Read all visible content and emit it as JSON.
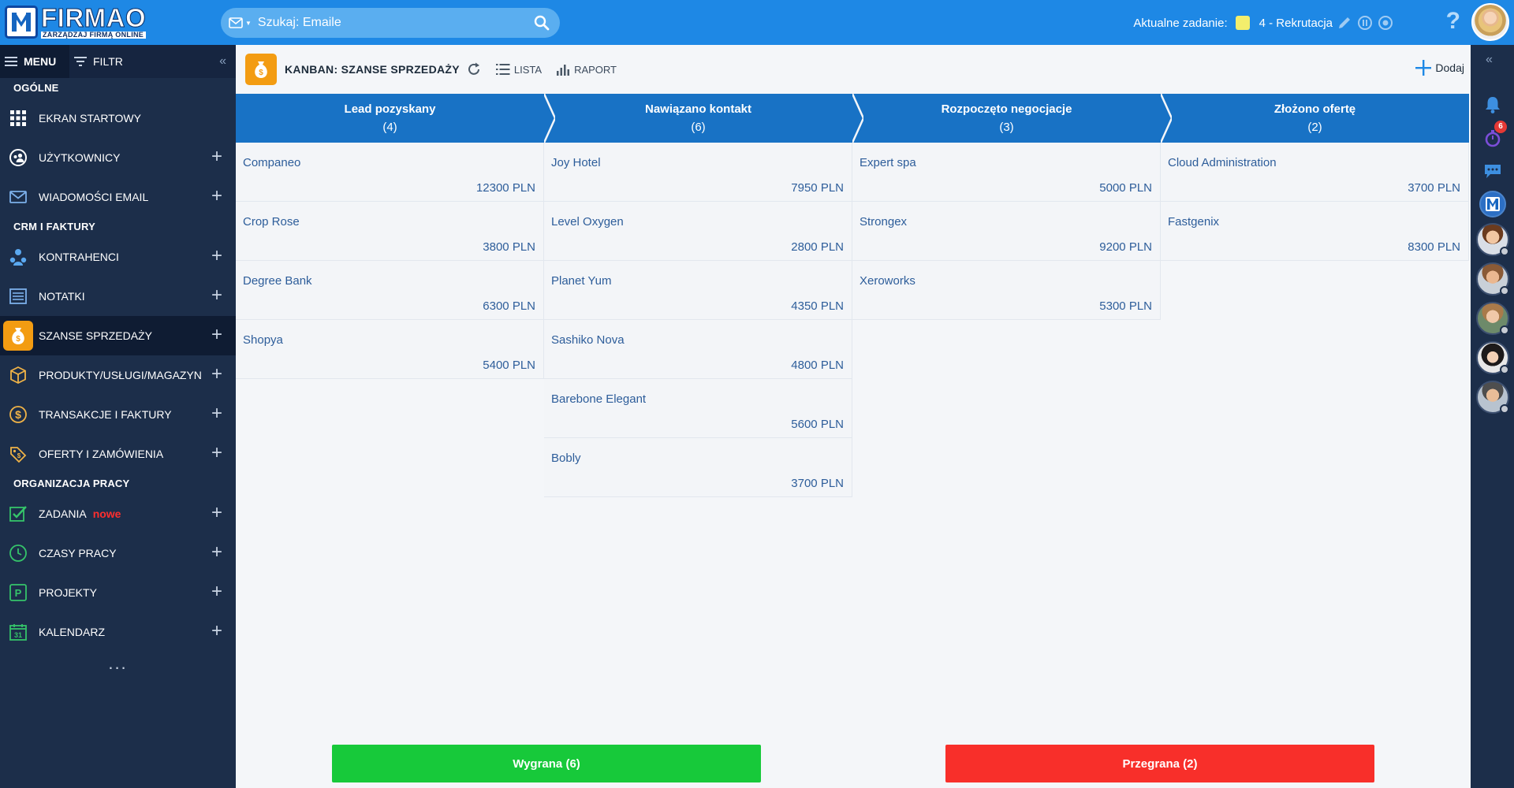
{
  "app": {
    "logo_title": "FIRMAO",
    "logo_subtitle": "ZARZĄDZAJ FIRMĄ ONLINE"
  },
  "search": {
    "placeholder": "Szukaj: Emaile",
    "scope_icon": "mail-icon"
  },
  "current_task": {
    "label": "Aktualne zadanie:",
    "name": "4 - Rekrutacja",
    "color": "#f3ee6c"
  },
  "help": {
    "label": "?"
  },
  "sidebar": {
    "tabs": [
      {
        "label": "MENU",
        "icon": "hamburger-icon"
      },
      {
        "label": "FILTR",
        "icon": "filter-icon"
      }
    ],
    "sections": [
      {
        "title": "OGÓLNE",
        "items": [
          {
            "label": "EKRAN STARTOWY",
            "icon": "grid-icon",
            "plus": false
          },
          {
            "label": "UŻYTKOWNICY",
            "icon": "users-icon",
            "plus": true
          },
          {
            "label": "WIADOMOŚCI EMAIL",
            "icon": "mail-icon",
            "plus": true
          }
        ]
      },
      {
        "title": "CRM I FAKTURY",
        "items": [
          {
            "label": "KONTRAHENCI",
            "icon": "contacts-icon",
            "plus": true
          },
          {
            "label": "NOTATKI",
            "icon": "notes-icon",
            "plus": true
          },
          {
            "label": "SZANSE SPRZEDAŻY",
            "icon": "money-bag-icon",
            "plus": true,
            "active": true
          },
          {
            "label": "PRODUKTY/USŁUGI/MAGAZYN",
            "icon": "box-icon",
            "plus": true
          },
          {
            "label": "TRANSAKCJE I FAKTURY",
            "icon": "dollar-icon",
            "plus": true
          },
          {
            "label": "OFERTY I ZAMÓWIENIA",
            "icon": "tag-icon",
            "plus": true
          }
        ]
      },
      {
        "title": "ORGANIZACJA PRACY",
        "items": [
          {
            "label": "ZADANIA",
            "icon": "checkbox-icon",
            "plus": true,
            "badge": "nowe"
          },
          {
            "label": "CZASY PRACY",
            "icon": "clock-icon",
            "plus": true
          },
          {
            "label": "PROJEKTY",
            "icon": "project-icon",
            "plus": true
          },
          {
            "label": "KALENDARZ",
            "icon": "calendar-icon",
            "plus": true,
            "calendar_day": "31"
          }
        ]
      }
    ],
    "more": "..."
  },
  "toolbar": {
    "title": "KANBAN: SZANSE SPRZEDAŻY",
    "list_label": "LISTA",
    "report_label": "RAPORT",
    "add_label": "Dodaj"
  },
  "kanban": {
    "stages": [
      {
        "name": "Lead pozyskany",
        "count": "(4)",
        "cards": [
          {
            "name": "Companeo",
            "value": "12300 PLN"
          },
          {
            "name": "Crop Rose",
            "value": "3800 PLN"
          },
          {
            "name": "Degree Bank",
            "value": "6300 PLN"
          },
          {
            "name": "Shopya",
            "value": "5400 PLN"
          }
        ]
      },
      {
        "name": "Nawiązano kontakt",
        "count": "(6)",
        "cards": [
          {
            "name": "Joy Hotel",
            "value": "7950 PLN"
          },
          {
            "name": "Level Oxygen",
            "value": "2800 PLN"
          },
          {
            "name": "Planet Yum",
            "value": "4350 PLN"
          },
          {
            "name": "Sashiko Nova",
            "value": "4800 PLN"
          },
          {
            "name": "Barebone Elegant",
            "value": "5600 PLN"
          },
          {
            "name": "Bobly",
            "value": "3700 PLN"
          }
        ]
      },
      {
        "name": "Rozpoczęto negocjacje",
        "count": "(3)",
        "cards": [
          {
            "name": "Expert spa",
            "value": "5000 PLN"
          },
          {
            "name": "Strongex",
            "value": "9200 PLN"
          },
          {
            "name": "Xeroworks",
            "value": "5300 PLN"
          }
        ]
      },
      {
        "name": "Złożono ofertę",
        "count": "(2)",
        "cards": [
          {
            "name": "Cloud Administration",
            "value": "3700 PLN"
          },
          {
            "name": "Fastgenix",
            "value": "8300 PLN"
          }
        ]
      }
    ]
  },
  "outcomes": {
    "won_label": "Wygrana (6)",
    "lost_label": "Przegrana (2)",
    "won_color": "#17c93a",
    "lost_color": "#f82f2a"
  },
  "rail": {
    "items": [
      {
        "icon": "bell-icon"
      },
      {
        "icon": "stopwatch-icon",
        "badge": "6"
      },
      {
        "icon": "chat-icon"
      },
      {
        "icon": "firmao-logo-icon"
      }
    ],
    "people_count": 5
  },
  "colors": {
    "topbar": "#1e88e5",
    "sidebar": "#1c2e4a",
    "stage": "#1872c5",
    "accent": "#f39c12",
    "link": "#2d5d9a"
  }
}
